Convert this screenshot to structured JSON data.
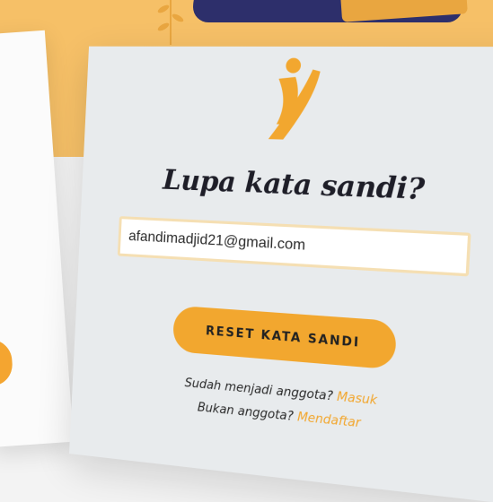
{
  "form": {
    "title": "Lupa kata sandi?",
    "email_value": "afandimadjid21@gmail.com",
    "reset_label": "RESET KATA SANDI",
    "member_text": "Sudah menjadi anggota?",
    "login_link": "Masuk",
    "nonmember_text": "Bukan anggota?",
    "register_link": "Mendaftar"
  },
  "colors": {
    "accent": "#f2a72f",
    "card_bg": "#e8ebed",
    "title": "#1e1e28"
  },
  "icons": {
    "logo": "brand-logo-icon"
  }
}
